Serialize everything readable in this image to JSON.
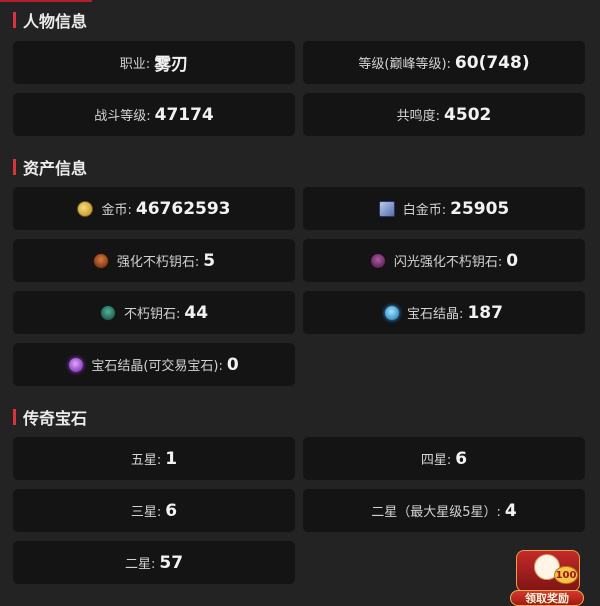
{
  "character": {
    "title": "人物信息",
    "items": [
      {
        "label": "职业:",
        "value": "雾刃"
      },
      {
        "label": "等级(巅峰等级):",
        "value": "60(748)"
      },
      {
        "label": "战斗等级:",
        "value": "47174"
      },
      {
        "label": "共鸣度:",
        "value": "4502"
      }
    ]
  },
  "assets": {
    "title": "资产信息",
    "items": [
      {
        "label": "金币:",
        "value": "46762593",
        "icon": "gold-coin-icon"
      },
      {
        "label": "白金币:",
        "value": "25905",
        "icon": "platinum-coin-icon"
      },
      {
        "label": "强化不朽钥石:",
        "value": "5",
        "icon": "enhanced-immortal-keystone-icon"
      },
      {
        "label": "闪光强化不朽钥石:",
        "value": "0",
        "icon": "shiny-enhanced-keystone-icon"
      },
      {
        "label": "不朽钥石:",
        "value": "44",
        "icon": "immortal-keystone-icon"
      },
      {
        "label": "宝石结晶:",
        "value": "187",
        "icon": "gem-crystal-icon"
      },
      {
        "label": "宝石结晶(可交易宝石):",
        "value": "0",
        "icon": "tradable-gem-crystal-icon"
      }
    ]
  },
  "legendary_gems": {
    "title": "传奇宝石",
    "items": [
      {
        "label": "五星:",
        "value": "1"
      },
      {
        "label": "四星:",
        "value": "6"
      },
      {
        "label": "三星:",
        "value": "6"
      },
      {
        "label": "二星（最大星级5星）:",
        "value": "4"
      },
      {
        "label": "二星:",
        "value": "57"
      }
    ]
  },
  "reward_widget": {
    "badge": "100",
    "button_label": "领取奖励"
  }
}
